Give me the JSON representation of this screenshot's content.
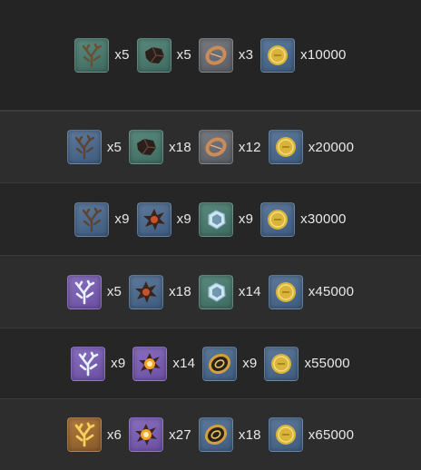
{
  "rows": [
    {
      "items": [
        {
          "icon": "green-coral-icon",
          "qty": "x5"
        },
        {
          "icon": "dark-shell-icon",
          "qty": "x5"
        },
        {
          "icon": "copper-ring-icon",
          "qty": "x3"
        },
        {
          "icon": "gold-coin-icon",
          "qty": "x10000"
        }
      ]
    },
    {
      "items": [
        {
          "icon": "blue-coral-icon",
          "qty": "x5"
        },
        {
          "icon": "dark-shell-icon",
          "qty": "x18"
        },
        {
          "icon": "copper-ring-icon",
          "qty": "x12"
        },
        {
          "icon": "gold-coin-icon",
          "qty": "x20000"
        }
      ]
    },
    {
      "items": [
        {
          "icon": "blue-coral-icon",
          "qty": "x9"
        },
        {
          "icon": "spiked-shell-icon",
          "qty": "x9"
        },
        {
          "icon": "crystal-ring-icon",
          "qty": "x9"
        },
        {
          "icon": "gold-coin-icon",
          "qty": "x30000"
        }
      ]
    },
    {
      "items": [
        {
          "icon": "white-coral-icon",
          "qty": "x5"
        },
        {
          "icon": "spiked-shell-icon",
          "qty": "x18"
        },
        {
          "icon": "crystal-ring-icon",
          "qty": "x14"
        },
        {
          "icon": "gold-coin-icon",
          "qty": "x45000"
        }
      ]
    },
    {
      "items": [
        {
          "icon": "white-coral-icon",
          "qty": "x9"
        },
        {
          "icon": "glowing-shell-icon",
          "qty": "x14"
        },
        {
          "icon": "gold-ring-icon",
          "qty": "x9"
        },
        {
          "icon": "gold-coin-icon",
          "qty": "x55000"
        }
      ]
    },
    {
      "items": [
        {
          "icon": "golden-coral-icon",
          "qty": "x6"
        },
        {
          "icon": "glowing-shell-icon",
          "qty": "x27"
        },
        {
          "icon": "gold-ring-icon",
          "qty": "x18"
        },
        {
          "icon": "gold-coin-icon",
          "qty": "x65000"
        }
      ]
    }
  ]
}
